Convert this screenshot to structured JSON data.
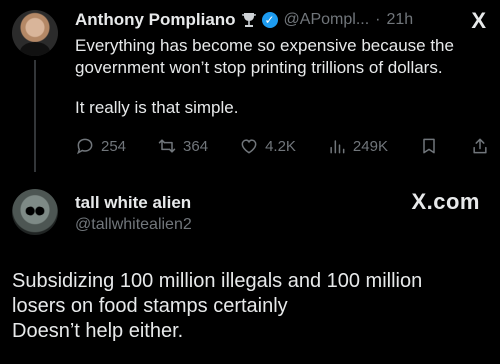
{
  "tweet": {
    "author_name": "Anthony Pompliano",
    "handle": "@APompl...",
    "time_sep": "·",
    "time": "21h",
    "x_logo": "X",
    "paragraph1": [
      "Everything has become so expensive because the",
      "government won’t stop printing trillions of dollars."
    ],
    "paragraph2": "It really is that simple.",
    "stats": {
      "replies": "254",
      "reposts": "364",
      "likes": "4.2K",
      "views": "249K"
    },
    "icons": [
      "trophy-icon",
      "verified-badge-icon",
      "x-logo-icon",
      "reply-icon",
      "repost-icon",
      "like-icon",
      "views-icon",
      "bookmark-icon",
      "share-icon"
    ]
  },
  "reply": {
    "author_name": "tall white alien",
    "handle": "@tallwhitealien2",
    "brand": "X.com",
    "lines": [
      "Subsidizing 100 million illegals and 100 million",
      "losers on food stamps certainly",
      "Doesn’t help either."
    ]
  },
  "colors": {
    "background": "#000000",
    "text": "#e7e9ea",
    "muted": "#71767b",
    "verified": "#1d9bf0"
  }
}
